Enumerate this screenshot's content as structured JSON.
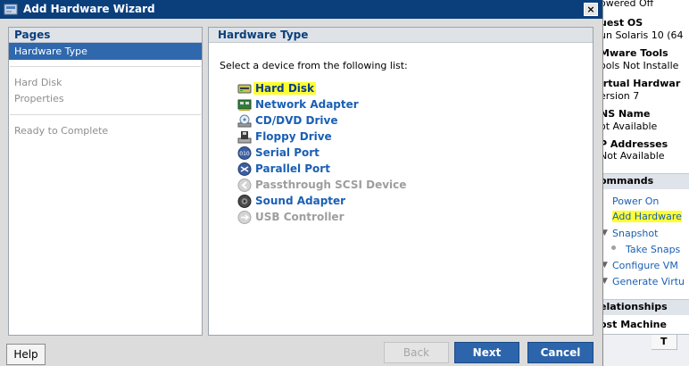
{
  "dialog": {
    "title": "Add Hardware Wizard",
    "close_glyph": "×"
  },
  "pages": {
    "header": "Pages",
    "items": [
      {
        "label": "Hardware Type",
        "selected": true
      },
      {
        "label": "Hard Disk",
        "selected": false
      },
      {
        "label": "Properties",
        "selected": false
      },
      {
        "label": "Ready to Complete",
        "selected": false
      }
    ]
  },
  "main": {
    "header": "Hardware Type",
    "prompt": "Select a device from the following list:",
    "devices": [
      {
        "label": "Hard Disk",
        "icon": "hard-disk-icon",
        "enabled": true,
        "highlighted": true
      },
      {
        "label": "Network Adapter",
        "icon": "network-adapter-icon",
        "enabled": true
      },
      {
        "label": "CD/DVD Drive",
        "icon": "cd-dvd-drive-icon",
        "enabled": true
      },
      {
        "label": "Floppy Drive",
        "icon": "floppy-drive-icon",
        "enabled": true
      },
      {
        "label": "Serial Port",
        "icon": "serial-port-icon",
        "enabled": true
      },
      {
        "label": "Parallel Port",
        "icon": "parallel-port-icon",
        "enabled": true
      },
      {
        "label": "Passthrough SCSI Device",
        "icon": "scsi-device-icon",
        "enabled": false
      },
      {
        "label": "Sound Adapter",
        "icon": "sound-adapter-icon",
        "enabled": true
      },
      {
        "label": "USB Controller",
        "icon": "usb-controller-icon",
        "enabled": false
      }
    ]
  },
  "buttons": {
    "help": "Help",
    "back": "Back",
    "next": "Next",
    "cancel": "Cancel"
  },
  "background_panel": {
    "state_value": "owered Off",
    "guest_os_label": "uest OS",
    "guest_os_value": "un Solaris 10 (64",
    "tools_label": "Mware Tools",
    "tools_value": "ools Not Installe",
    "vhw_label": "irtual Hardwar",
    "vhw_value": "ersion 7",
    "dns_label": "NS Name",
    "dns_value": "ot Available",
    "ip_label": "P Addresses",
    "ip_value": "Not Available",
    "commands_header": "ommands",
    "commands": {
      "power_on": "Power On",
      "add_hardware": "Add Hardware",
      "snapshot": "Snapshot",
      "take_snapshot": "Take Snaps",
      "configure_vm": "Configure VM",
      "generate": "Generate Virtu"
    },
    "relationships_header": "elationships",
    "host_machine": "ost Machine",
    "grid_header": "T"
  },
  "colors": {
    "title_bar": "#0b3f7c",
    "selected_page": "#2f68ad",
    "link_blue": "#1a5fb4",
    "primary_button": "#2c65ab",
    "highlight": "#ffff2e"
  }
}
